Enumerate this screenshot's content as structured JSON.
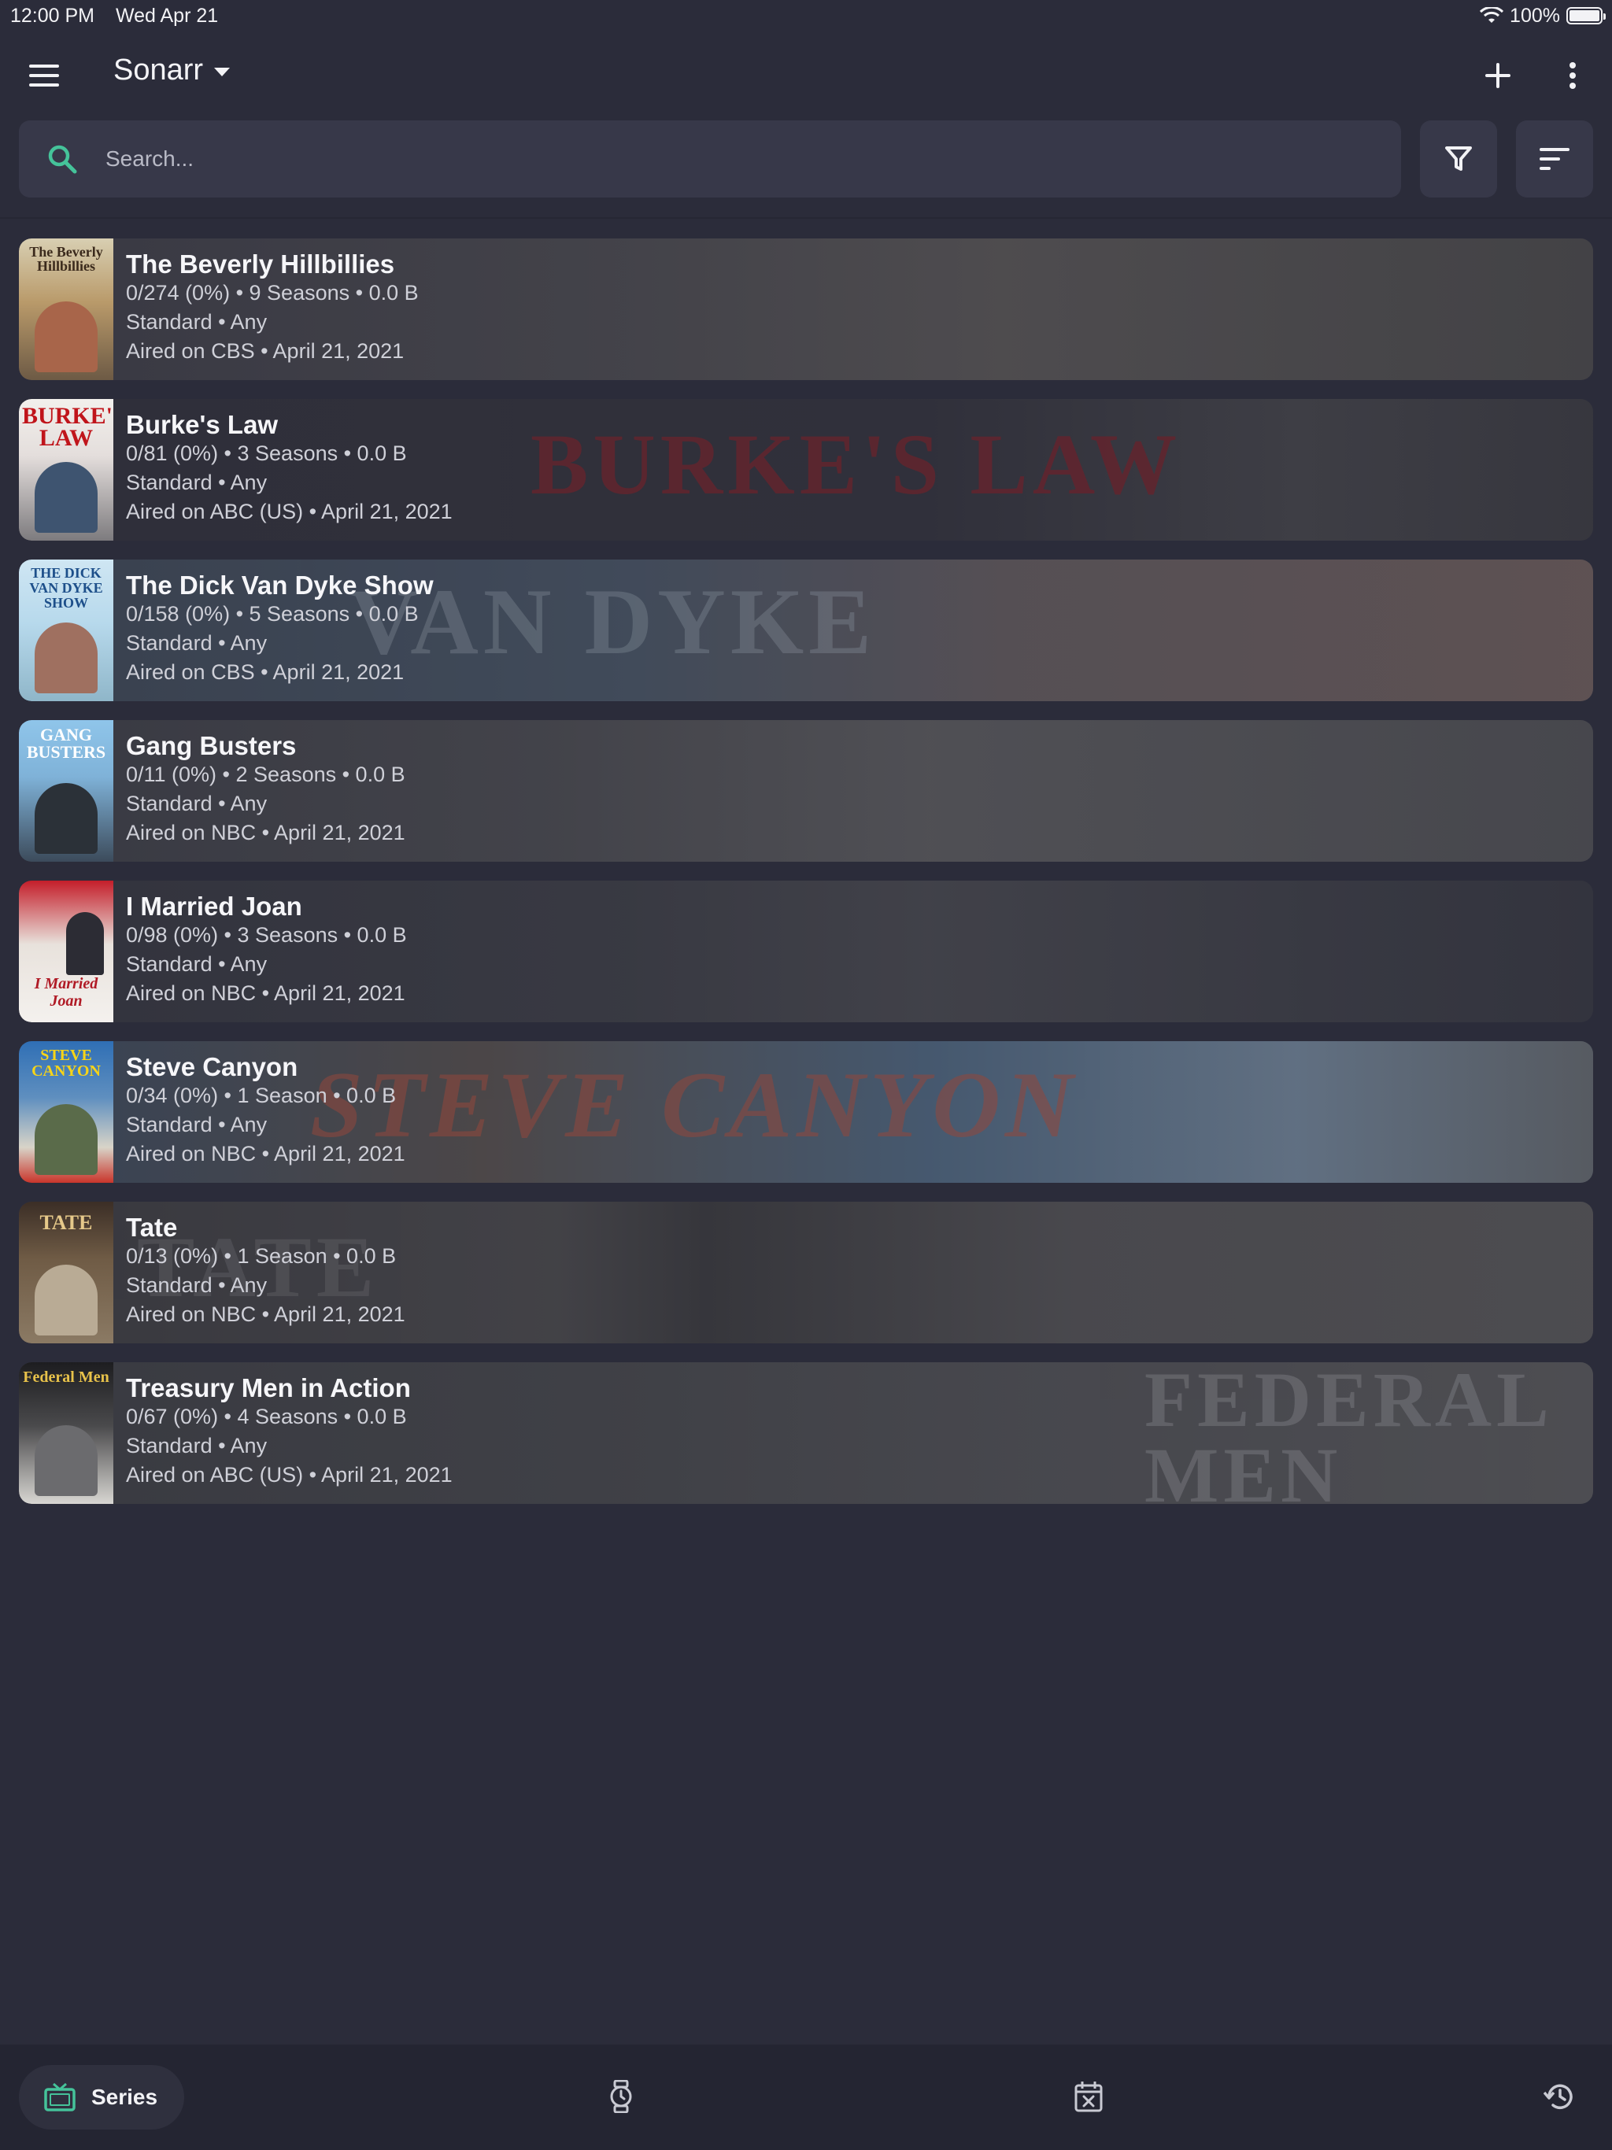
{
  "status_bar": {
    "time": "12:00 PM",
    "date": "Wed Apr 21",
    "battery": "100%"
  },
  "app_bar": {
    "title": "Sonarr"
  },
  "search": {
    "placeholder": "Search..."
  },
  "colors": {
    "accent": "#45c39a",
    "background": "#2b2c3a",
    "surface": "#373849"
  },
  "series": [
    {
      "title": "The Beverly Hillbillies",
      "stats": "0/274 (0%) • 9 Seasons • 0.0 B",
      "profile": "Standard • Any",
      "aired": "Aired on CBS • April 21, 2021",
      "poster_text": "The Beverly Hillbillies"
    },
    {
      "title": "Burke's Law",
      "stats": "0/81 (0%) • 3 Seasons • 0.0 B",
      "profile": "Standard • Any",
      "aired": "Aired on ABC (US) • April 21, 2021",
      "poster_text": "BURKE'S LAW",
      "banner_text": "BURKE'S LAW"
    },
    {
      "title": "The Dick Van Dyke Show",
      "stats": "0/158 (0%) • 5 Seasons • 0.0 B",
      "profile": "Standard • Any",
      "aired": "Aired on CBS • April 21, 2021",
      "poster_text": "THE DICK VAN DYKE SHOW",
      "banner_text": "VAN DYKE"
    },
    {
      "title": "Gang Busters",
      "stats": "0/11 (0%) • 2 Seasons • 0.0 B",
      "profile": "Standard • Any",
      "aired": "Aired on NBC • April 21, 2021",
      "poster_text": "GANG BUSTERS"
    },
    {
      "title": "I Married Joan",
      "stats": "0/98 (0%) • 3 Seasons • 0.0 B",
      "profile": "Standard • Any",
      "aired": "Aired on NBC • April 21, 2021",
      "poster_text": "I Married Joan"
    },
    {
      "title": "Steve Canyon",
      "stats": "0/34 (0%) • 1 Season • 0.0 B",
      "profile": "Standard • Any",
      "aired": "Aired on NBC • April 21, 2021",
      "poster_text": "STEVE CANYON",
      "banner_text": "STEVE CANYON"
    },
    {
      "title": "Tate",
      "stats": "0/13 (0%) • 1 Season • 0.0 B",
      "profile": "Standard • Any",
      "aired": "Aired on NBC • April 21, 2021",
      "poster_text": "TATE",
      "banner_text": "TATE"
    },
    {
      "title": "Treasury Men in Action",
      "stats": "0/67 (0%) • 4 Seasons • 0.0 B",
      "profile": "Standard • Any",
      "aired": "Aired on ABC (US) • April 21, 2021",
      "poster_text": "Federal Men",
      "banner_text": "FEDERAL MEN"
    }
  ],
  "bottom_nav": {
    "series_label": "Series"
  }
}
